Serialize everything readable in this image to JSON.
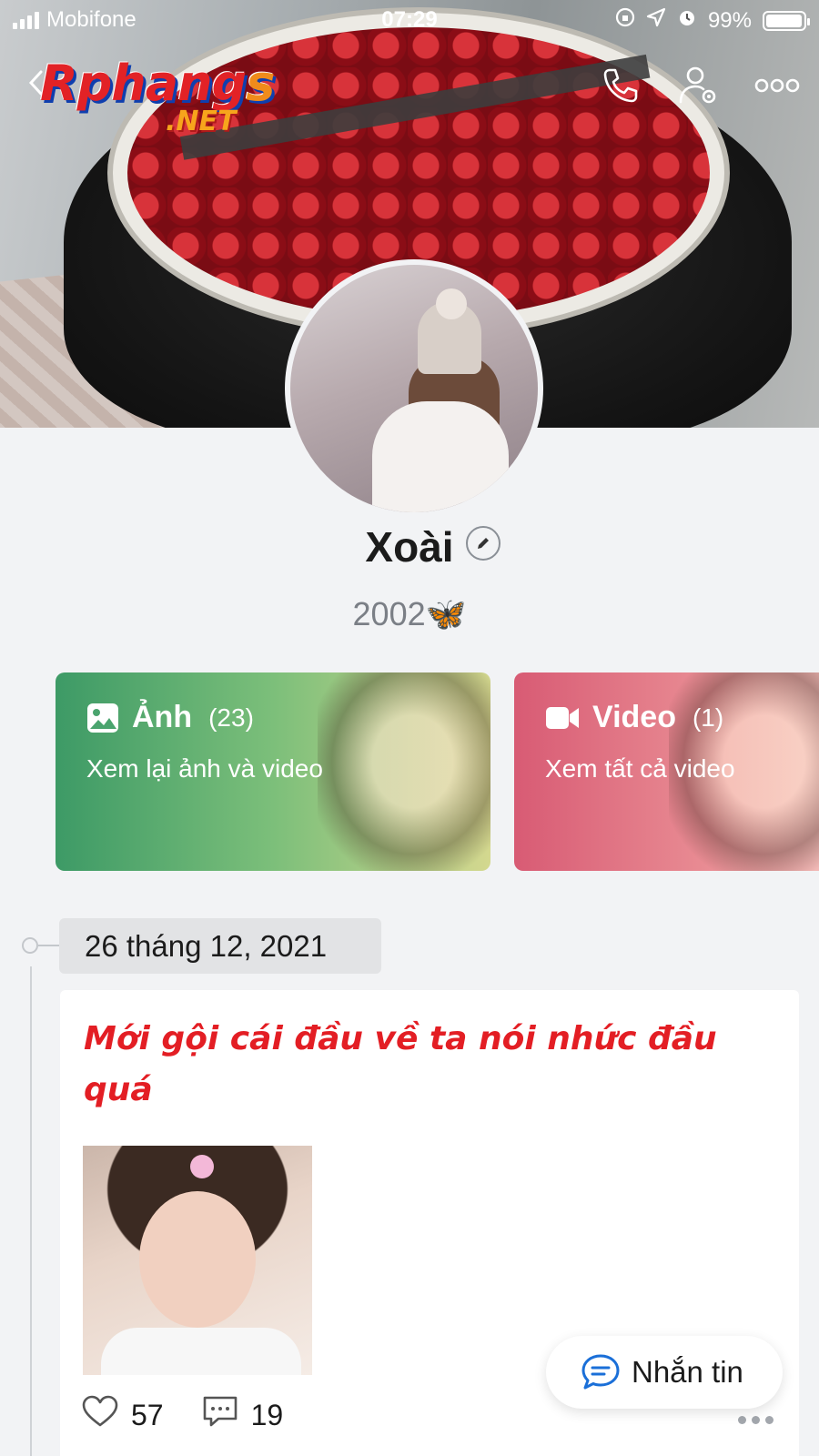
{
  "status_bar": {
    "carrier": "Mobifone",
    "time": "07:29",
    "battery": "99%",
    "battery_level": 0.99
  },
  "header": {
    "back_icon": "chevron-left-icon",
    "logo_brand": "Rphang",
    "logo_brand_s": "s",
    "logo_tld": ".NET",
    "icons": [
      "phone-icon",
      "user-settings-icon",
      "more-icon"
    ]
  },
  "profile": {
    "name": "Xoài",
    "bio_text": "2002",
    "bio_emoji": "🦋"
  },
  "media_cards": [
    {
      "icon": "image-icon",
      "title": "Ảnh",
      "count": "(23)",
      "subtitle": "Xem lại ảnh và video",
      "color": "#4aa46e"
    },
    {
      "icon": "video-camera-icon",
      "title": "Video",
      "count": "(1)",
      "subtitle": "Xem tất cả video",
      "color": "#de6b7e"
    }
  ],
  "timeline": {
    "date": "26 tháng 12, 2021",
    "post": {
      "text": "Mới gội cái đầu về ta nói nhức đầu quá",
      "text_color": "#e31e24",
      "likes": "57",
      "comments": "19"
    }
  },
  "message_button": {
    "label": "Nhắn tin",
    "icon": "chat-bubble-icon",
    "accent": "#1a6fd8"
  }
}
